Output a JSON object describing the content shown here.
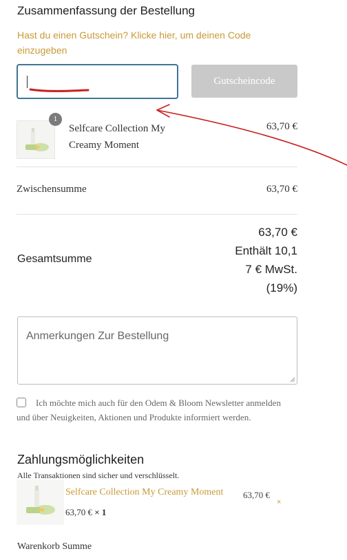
{
  "summary": {
    "title": "Zusammenfassung der Bestellung",
    "coupon_prompt": "Hast du einen Gutschein? Klicke hier, um deinen Code einzugeben"
  },
  "coupon": {
    "input_value": "",
    "button_label": "Gutscheincode"
  },
  "item": {
    "quantity_badge": "1",
    "name": "Selfcare Collection My Creamy Moment",
    "price": "63,70 €"
  },
  "subtotal": {
    "label": "Zwischensumme",
    "value": "63,70 €"
  },
  "total": {
    "label": "Gesamtsumme",
    "lines": [
      "63,70 €",
      "Enthält 10,1",
      "7 € MwSt.",
      "(19%)"
    ]
  },
  "notes": {
    "placeholder": "Anmerkungen Zur Bestellung"
  },
  "newsletter": {
    "text": "Ich möchte mich auch für den Odem & Bloom Newsletter anmelden und über Neuigkeiten, Aktionen und Produkte informiert werden."
  },
  "payment": {
    "title": "Zahlungsmöglichkeiten",
    "subtitle": "Alle Transaktionen sind sicher und verschlüsselt."
  },
  "mini_cart": {
    "name": "Selfcare Collection My Creamy Moment",
    "price": "63,70 €",
    "remove_symbol": "×",
    "line_price": "63,70 €",
    "line_qty": "× 1"
  },
  "cart_total": {
    "label": "Warenkorb Summe"
  },
  "colors": {
    "accent_gold": "#c89a36",
    "input_focus_border": "#3f7396",
    "button_disabled": "#c9c9c9",
    "annotation_red": "#c8201f"
  }
}
